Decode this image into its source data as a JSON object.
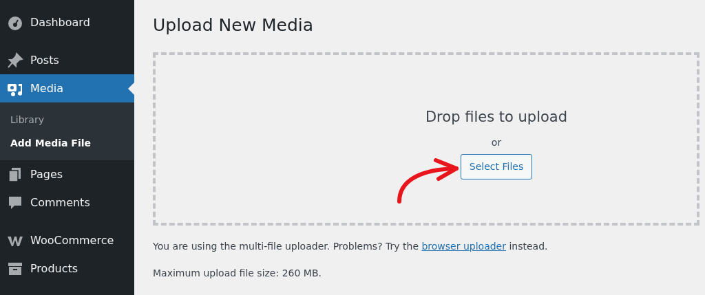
{
  "sidebar": {
    "groups": [
      {
        "items": [
          {
            "label": "Dashboard",
            "selected": false
          }
        ]
      },
      {
        "items": [
          {
            "label": "Posts",
            "selected": false
          },
          {
            "label": "Media",
            "selected": true,
            "children": [
              {
                "label": "Library",
                "selected": false
              },
              {
                "label": "Add Media File",
                "selected": true
              }
            ]
          },
          {
            "label": "Pages",
            "selected": false
          },
          {
            "label": "Comments",
            "selected": false
          }
        ]
      },
      {
        "items": [
          {
            "label": "WooCommerce",
            "selected": false
          },
          {
            "label": "Products",
            "selected": false
          }
        ]
      }
    ]
  },
  "page": {
    "title": "Upload New Media",
    "dropzone": {
      "heading": "Drop files to upload",
      "or": "or",
      "button": "Select Files"
    },
    "notice": {
      "before": "You are using the multi-file uploader. Problems? Try the",
      "link": "browser uploader",
      "after": "instead."
    },
    "max_size": "Maximum upload file size: 260 MB."
  }
}
